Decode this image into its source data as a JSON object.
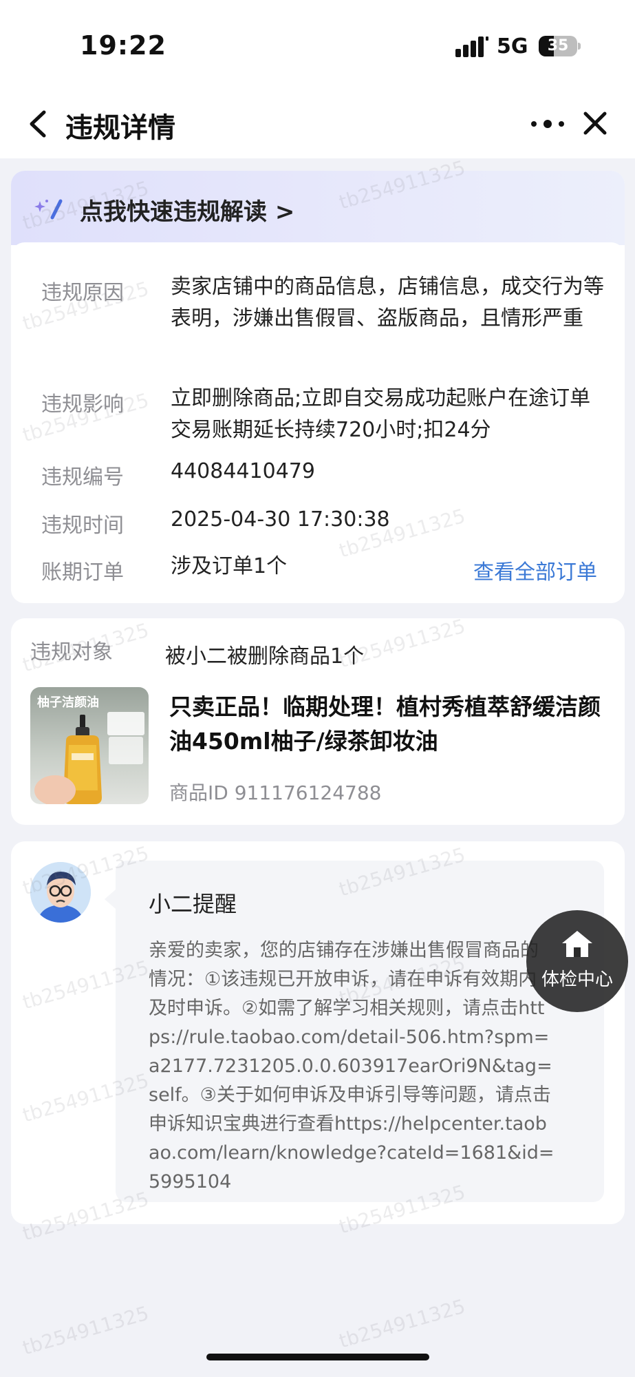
{
  "status_bar": {
    "time": "19:22",
    "network": "5G",
    "battery": "35"
  },
  "nav": {
    "title": "违规详情"
  },
  "quick_banner": {
    "label": "点我快速违规解读 >"
  },
  "violation_info": {
    "reason_label": "违规原因",
    "reason_value": "卖家店铺中的商品信息，店铺信息，成交行为等表明，涉嫌出售假冒、盗版商品，且情形严重",
    "impact_label": "违规影响",
    "impact_value": "立即删除商品;立即自交易成功起账户在途订单交易账期延长持续720小时;扣24分",
    "id_label": "违规编号",
    "id_value": "44084410479",
    "time_label": "违规时间",
    "time_value": "2025-04-30 17:30:38",
    "orders_label": "账期订单",
    "orders_value": "涉及订单1个",
    "view_orders_link": "查看全部订单"
  },
  "violation_target": {
    "label": "违规对象",
    "count_text": "被小二被删除商品1个",
    "product": {
      "thumb_tag": "柚子洁颜油",
      "title": "只卖正品！临期处理！植村秀植萃舒缓洁颜油450ml柚子/绿茶卸妆油",
      "id_text": "商品ID 911176124788"
    }
  },
  "reminder": {
    "title": "小二提醒",
    "text": "亲爱的卖家，您的店铺存在涉嫌出售假冒商品的情况：①该违规已开放申诉，请在申诉有效期内及时申诉。②如需了解学习相关规则，请点击https://rule.taobao.com/detail-506.htm?spm=a2177.7231205.0.0.603917earOri9N&tag=self。③关于如何申诉及申诉引导等问题，请点击申诉知识宝典进行查看https://helpcenter.taobao.com/learn/knowledge?cateId=1681&id=5995104"
  },
  "floating_button": {
    "label": "体检中心",
    "icon": "home-icon"
  },
  "watermark_text": "tb254911325",
  "colors": {
    "link": "#3b79d6",
    "background": "#f1f2f7",
    "banner": "#dfe0fb"
  }
}
